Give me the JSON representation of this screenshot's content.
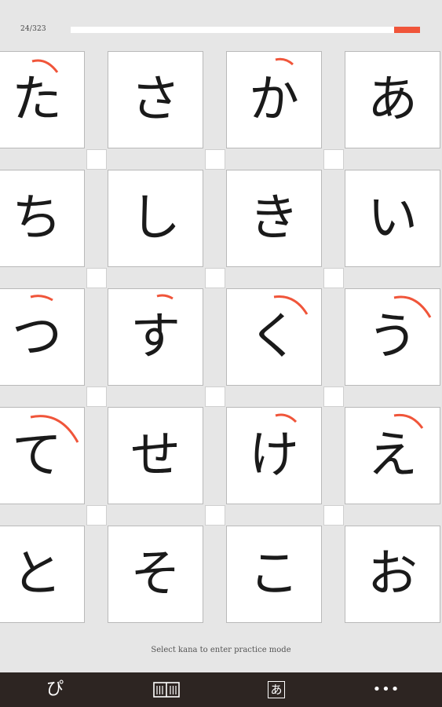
{
  "progress": {
    "text": "24/323",
    "fraction": 0.074,
    "fill_color": "#f0553a"
  },
  "grid": {
    "rows": [
      [
        "た",
        "さ",
        "か",
        "あ"
      ],
      [
        "ち",
        "し",
        "き",
        "い"
      ],
      [
        "つ",
        "す",
        "く",
        "う"
      ],
      [
        "て",
        "せ",
        "け",
        "え"
      ],
      [
        "と",
        "そ",
        "こ",
        "お"
      ]
    ]
  },
  "hint": "Select kana to enter practice mode",
  "toolbar": {
    "items": [
      {
        "glyph": "ぴ",
        "icon": "hiragana-mode-icon"
      },
      {
        "glyph": "📖",
        "icon": "book-icon"
      },
      {
        "glyph": "あ",
        "icon": "kana-chart-icon"
      },
      {
        "glyph": "•••",
        "icon": "more-icon"
      }
    ]
  },
  "colors": {
    "background": "#e6e6e6",
    "accent": "#f0553a",
    "bottom_bar": "#2d2522"
  }
}
